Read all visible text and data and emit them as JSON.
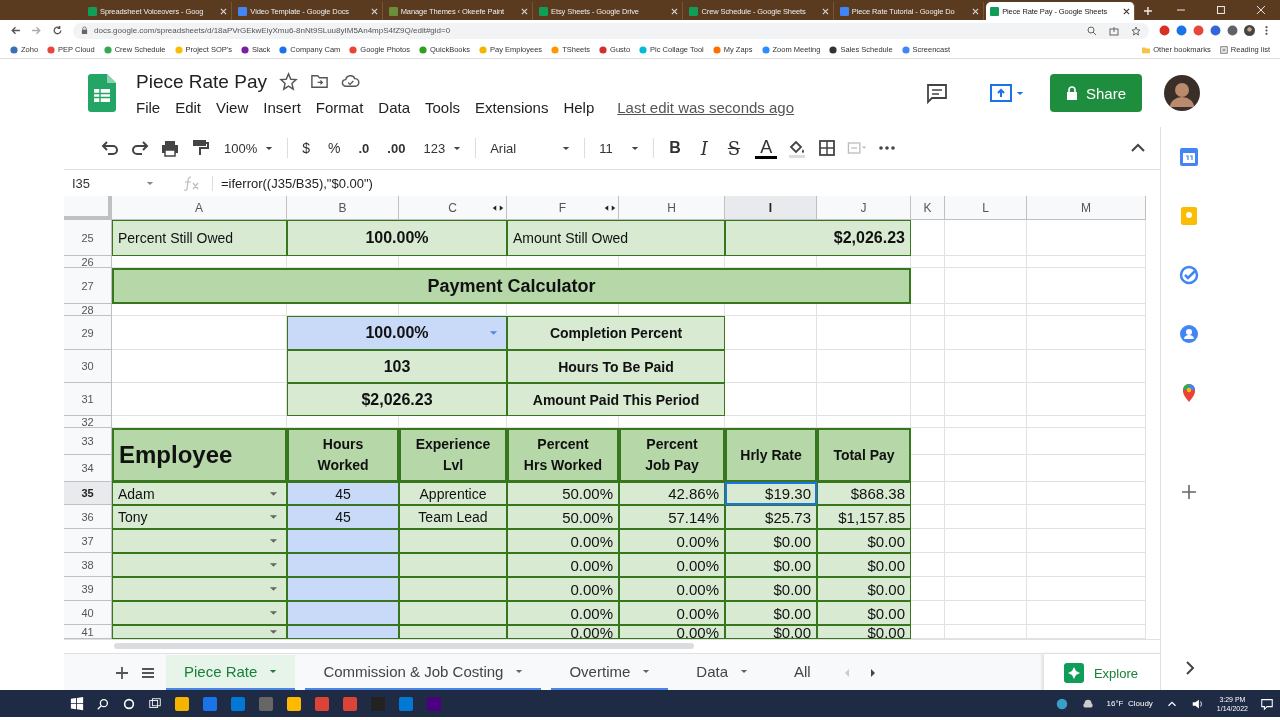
{
  "browser": {
    "tabs": [
      {
        "title": "Spreadsheet Voiceovers - Goog",
        "selected": false
      },
      {
        "title": "Video Template - Google Docs",
        "selected": false
      },
      {
        "title": "Manage Themes ‹ Okeefe Paint",
        "selected": false
      },
      {
        "title": "Etsy Sheets - Google Drive",
        "selected": false
      },
      {
        "title": "Crew Schedule - Google Sheets",
        "selected": false
      },
      {
        "title": "Piece Rate Tutorial - Google Do",
        "selected": false
      },
      {
        "title": "Piece Rate Pay - Google Sheets",
        "selected": true
      }
    ],
    "address": "docs.google.com/spreadsheets/d/18aPVrGEkwEiyXmu6-8nNt9SLuu8yIM5An4mpS4fZ9Q/edit#gid=0",
    "bookmarks": [
      "Zoho",
      "PEP Cloud",
      "Crew Schedule",
      "Project SOP's",
      "Slack",
      "Company Cam",
      "Google Photos",
      "QuickBooks",
      "Pay Employees",
      "TSheets",
      "Gusto",
      "Pic Collage Tool",
      "My Zaps",
      "Zoom Meeting",
      "Sales Schedule",
      "Screencast"
    ],
    "other_bookmarks": "Other bookmarks",
    "reading_list": "Reading list"
  },
  "document": {
    "title": "Piece Rate Pay",
    "menus": [
      "File",
      "Edit",
      "View",
      "Insert",
      "Format",
      "Data",
      "Tools",
      "Extensions",
      "Help"
    ],
    "last_edit": "Last edit was seconds ago",
    "share": "Share"
  },
  "toolbar": {
    "zoom": "100%",
    "currency": "$",
    "percent": "%",
    "decrease_decimals": ".0",
    "increase_decimals": ".00",
    "number_format": "123",
    "font": "Arial",
    "font_size": "11",
    "format_buttons": [
      {
        "label": "B",
        "kind": "bold"
      },
      {
        "label": "I",
        "kind": "italic"
      },
      {
        "label": "S",
        "kind": "strike"
      },
      {
        "label": "A",
        "kind": "color"
      }
    ]
  },
  "formula_bar": {
    "cell": "I35",
    "formula": "=iferror((J35/B35),\"$0.00\")"
  },
  "column_headers": [
    {
      "label": "A",
      "selected": false,
      "hidden_after": false
    },
    {
      "label": "B",
      "selected": false,
      "hidden_after": false
    },
    {
      "label": "C",
      "selected": false,
      "hidden_after": true
    },
    {
      "label": "F",
      "selected": false,
      "hidden_after": true
    },
    {
      "label": "H",
      "selected": false,
      "hidden_after": false
    },
    {
      "label": "I",
      "selected": true,
      "hidden_after": false
    },
    {
      "label": "J",
      "selected": false,
      "hidden_after": false
    },
    {
      "label": "K",
      "selected": false,
      "hidden_after": false
    },
    {
      "label": "L",
      "selected": false,
      "hidden_after": false
    },
    {
      "label": "M",
      "selected": false,
      "hidden_after": false
    }
  ],
  "row_headers": [
    {
      "label": "25",
      "selected": false
    },
    {
      "label": "26",
      "selected": false
    },
    {
      "label": "27",
      "selected": false
    },
    {
      "label": "28",
      "selected": false
    },
    {
      "label": "29",
      "selected": false
    },
    {
      "label": "30",
      "selected": false
    },
    {
      "label": "31",
      "selected": false
    },
    {
      "label": "32",
      "selected": false
    },
    {
      "label": "33",
      "selected": false
    },
    {
      "label": "34",
      "selected": false
    },
    {
      "label": "35",
      "selected": true
    },
    {
      "label": "36",
      "selected": false
    },
    {
      "label": "37",
      "selected": false
    },
    {
      "label": "38",
      "selected": false
    },
    {
      "label": "39",
      "selected": false
    },
    {
      "label": "40",
      "selected": false
    },
    {
      "label": "41",
      "selected": false
    }
  ],
  "summary": {
    "percent_label": "Percent Still Owed",
    "percent": "100.00%",
    "amount_label": "Amount Still Owed",
    "amount": "$2,026.23"
  },
  "calculator": {
    "title": "Payment Calculator",
    "rows": [
      {
        "value": "100.00%",
        "label": "Completion Percent",
        "dropdown": true
      },
      {
        "value": "103",
        "label": "Hours To Be Paid",
        "dropdown": false
      },
      {
        "value": "$2,026.23",
        "label": "Amount Paid This Period",
        "dropdown": false
      }
    ]
  },
  "employees": {
    "title": "Employee",
    "headers": [
      "Hours\nWorked",
      "Experience\nLvl",
      "Percent\nHrs Worked",
      "Percent\nJob Pay",
      "Hrly Rate",
      "Total Pay"
    ],
    "rows": [
      {
        "name": "Adam",
        "hours": "45",
        "level": "Apprentice",
        "pct_hours": "50.00%",
        "pct_pay": "42.86%",
        "rate": "$19.30",
        "total": "$868.38",
        "selected": true
      },
      {
        "name": "Tony",
        "hours": "45",
        "level": "Team Lead",
        "pct_hours": "50.00%",
        "pct_pay": "57.14%",
        "rate": "$25.73",
        "total": "$1,157.85",
        "selected": false
      },
      {
        "pct_hours": "0.00%",
        "pct_pay": "0.00%",
        "rate": "$0.00",
        "total": "$0.00",
        "selected": false
      },
      {
        "pct_hours": "0.00%",
        "pct_pay": "0.00%",
        "rate": "$0.00",
        "total": "$0.00",
        "selected": false
      },
      {
        "pct_hours": "0.00%",
        "pct_pay": "0.00%",
        "rate": "$0.00",
        "total": "$0.00",
        "selected": false
      },
      {
        "pct_hours": "0.00%",
        "pct_pay": "0.00%",
        "rate": "$0.00",
        "total": "$0.00",
        "selected": false
      },
      {
        "pct_hours": "0.00%",
        "pct_pay": "0.00%",
        "rate": "$0.00",
        "total": "$0.00",
        "selected": false
      }
    ]
  },
  "sheet_tabs": [
    {
      "label": "Piece Rate",
      "selected": true,
      "color": "#4a86e8"
    },
    {
      "label": "Commission & Job Costing",
      "selected": false,
      "color": "#4a86e8"
    },
    {
      "label": "Overtime",
      "selected": false,
      "color": "#4a86e8"
    },
    {
      "label": "Data",
      "selected": false
    },
    {
      "label": "All",
      "selected": false
    }
  ],
  "explore": "Explore",
  "taskbar": {
    "weather": "16°F  Cloudy",
    "time": "3:29 PM",
    "date": "1/14/2022"
  }
}
